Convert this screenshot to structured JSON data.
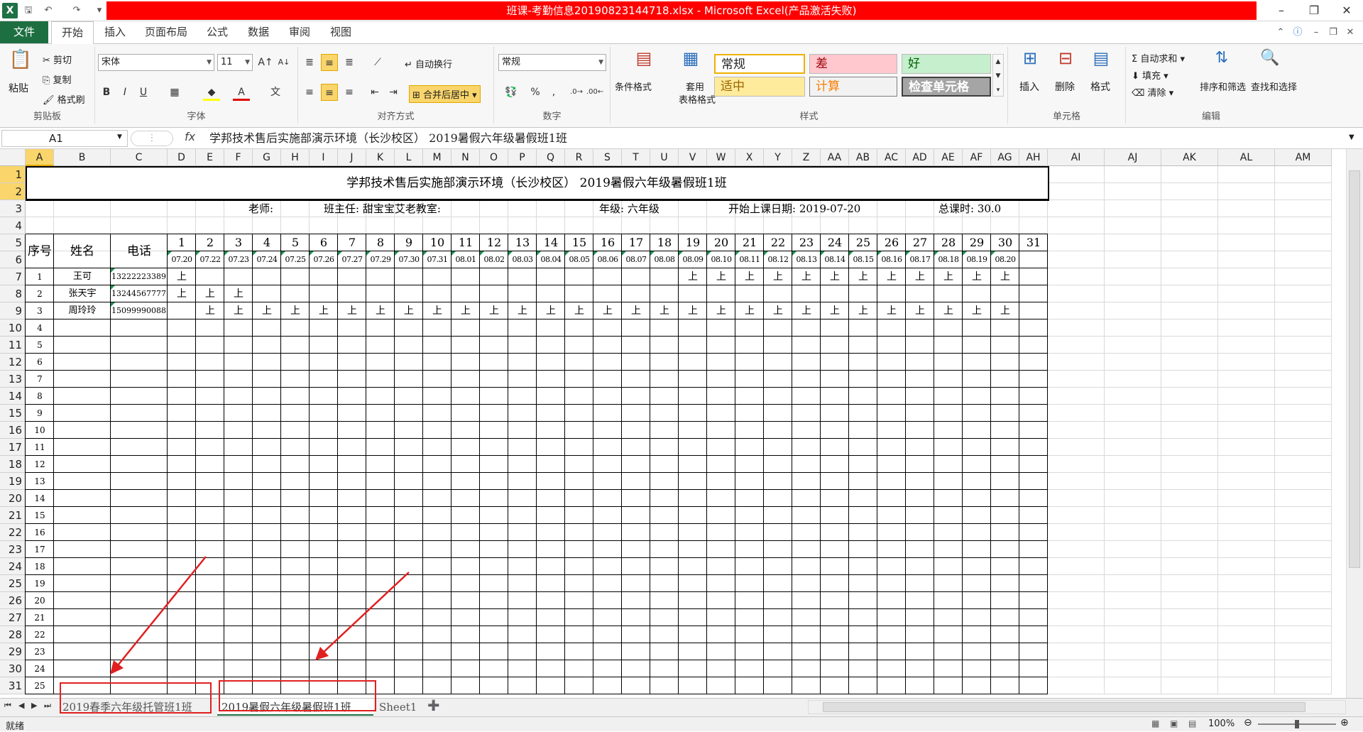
{
  "window": {
    "title": "班课-考勤信息20190823144718.xlsx - Microsoft Excel(产品激活失败)"
  },
  "ribbon": {
    "tabs": [
      "文件",
      "开始",
      "插入",
      "页面布局",
      "公式",
      "数据",
      "审阅",
      "视图"
    ],
    "clipboard": {
      "group": "剪贴板",
      "paste": "粘贴",
      "cut": "剪切",
      "copy": "复制",
      "format_painter": "格式刷"
    },
    "font": {
      "group": "字体",
      "name": "宋体",
      "size": "11"
    },
    "alignment": {
      "group": "对齐方式",
      "wrap": "自动换行",
      "merge": "合并后居中"
    },
    "number": {
      "group": "数字",
      "format": "常规"
    },
    "styles": {
      "group": "样式",
      "conditional": "条件格式",
      "table_fmt_1": "套用",
      "table_fmt_2": "表格格式",
      "cells": [
        "常规",
        "差",
        "好",
        "适中",
        "计算",
        "检查单元格"
      ]
    },
    "cells": {
      "group": "单元格",
      "insert": "插入",
      "delete": "删除",
      "format": "格式"
    },
    "editing": {
      "group": "编辑",
      "autosum": "自动求和",
      "fill": "填充",
      "clear": "清除",
      "sort": "排序和筛选",
      "find": "查找和选择"
    }
  },
  "formula_bar": {
    "name_box": "A1",
    "fx": "fx",
    "content": "学邦技术售后实施部演示环境（长沙校区） 2019暑假六年级暑假班1班"
  },
  "sheet": {
    "title": "学邦技术售后实施部演示环境（长沙校区） 2019暑假六年级暑假班1班",
    "info": {
      "teacher": "老师:",
      "headteacher": "班主任: 甜宝宝艾老教室:",
      "grade": "年级: 六年级",
      "start": "开始上课日期: 2019-07-20",
      "hours": "总课时: 30.0"
    },
    "header": {
      "seq": "序号",
      "name": "姓名",
      "phone": "电话"
    },
    "day_numbers": [
      "1",
      "2",
      "3",
      "4",
      "5",
      "6",
      "7",
      "8",
      "9",
      "10",
      "11",
      "12",
      "13",
      "14",
      "15",
      "16",
      "17",
      "18",
      "19",
      "20",
      "21",
      "22",
      "23",
      "24",
      "25",
      "26",
      "27",
      "28",
      "29",
      "30",
      "31"
    ],
    "dates": [
      "07.20",
      "07.22",
      "07.23",
      "07.24",
      "07.25",
      "07.26",
      "07.27",
      "07.29",
      "07.30",
      "07.31",
      "08.01",
      "08.02",
      "08.03",
      "08.04",
      "08.05",
      "08.06",
      "08.07",
      "08.08",
      "08.09",
      "08.10",
      "08.11",
      "08.12",
      "08.13",
      "08.14",
      "08.15",
      "08.16",
      "08.17",
      "08.18",
      "08.19",
      "08.20"
    ],
    "mark": "上",
    "students": [
      {
        "seq": "1",
        "name": "王可",
        "phone": "13222223389",
        "days": [
          1,
          19,
          20,
          21,
          22,
          23,
          24,
          25,
          26,
          27,
          28,
          29,
          30
        ]
      },
      {
        "seq": "2",
        "name": "张天宇",
        "phone": "13244567777",
        "days": [
          1,
          2,
          3
        ]
      },
      {
        "seq": "3",
        "name": "周玲玲",
        "phone": "15099990088",
        "days": [
          2,
          3,
          4,
          5,
          6,
          7,
          8,
          9,
          10,
          11,
          12,
          13,
          14,
          15,
          16,
          17,
          18,
          19,
          20,
          21,
          22,
          23,
          24,
          25,
          26,
          27,
          28,
          29,
          30
        ]
      }
    ],
    "seq_numbers": [
      "4",
      "5",
      "6",
      "7",
      "8",
      "9",
      "10",
      "11",
      "12",
      "13",
      "14",
      "15",
      "16",
      "17",
      "18",
      "19",
      "20",
      "21",
      "22",
      "23",
      "24",
      "25"
    ],
    "columns": [
      "A",
      "B",
      "C",
      "D",
      "E",
      "F",
      "G",
      "H",
      "I",
      "J",
      "K",
      "L",
      "M",
      "N",
      "O",
      "P",
      "Q",
      "R",
      "S",
      "T",
      "U",
      "V",
      "W",
      "X",
      "Y",
      "Z",
      "AA",
      "AB",
      "AC",
      "AD",
      "AE",
      "AF",
      "AG",
      "AH",
      "AI",
      "AJ",
      "AK",
      "AL",
      "AM"
    ],
    "rows": [
      "1",
      "2",
      "3",
      "4",
      "5",
      "6",
      "7",
      "8",
      "9",
      "10",
      "11",
      "12",
      "13",
      "14",
      "15",
      "16",
      "17",
      "18",
      "19",
      "20",
      "21",
      "22",
      "23",
      "24",
      "25",
      "26",
      "27",
      "28",
      "29",
      "30",
      "31"
    ]
  },
  "sheet_tabs": [
    "2019春季六年级托管班1班",
    "2019暑假六年级暑假班1班",
    "Sheet1"
  ],
  "status": {
    "ready": "就绪",
    "zoom": "100%"
  },
  "colors": {
    "annotation": "#e02020",
    "excel_green": "#1d6f42",
    "selection": "#f9d56b"
  }
}
